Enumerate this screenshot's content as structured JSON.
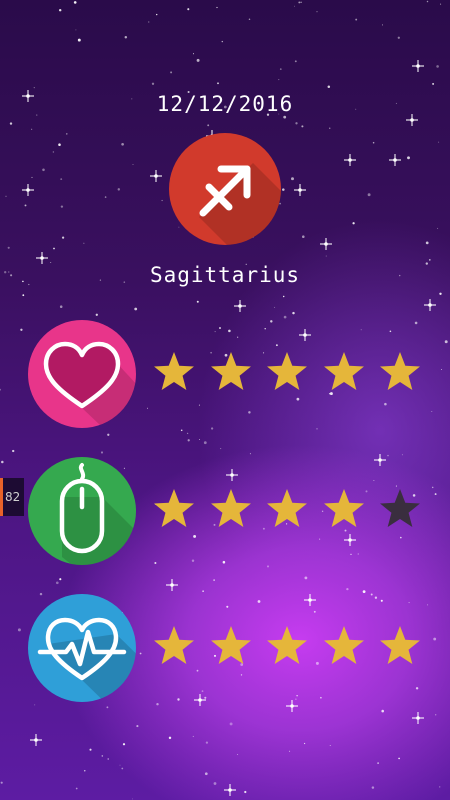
{
  "header": {
    "date": "12/12/2016",
    "sign_name": "Sagittarius",
    "sign_icon": "sagittarius-arrow-icon"
  },
  "ratings": [
    {
      "category_icon": "heart-icon",
      "circle_color": "#e8358a",
      "rating": 5,
      "max": 5
    },
    {
      "category_icon": "computer-mouse-icon",
      "circle_color": "#35a94f",
      "rating": 4,
      "max": 5
    },
    {
      "category_icon": "heartbeat-icon",
      "circle_color": "#2f9fd8",
      "rating": 5,
      "max": 5
    }
  ],
  "colors": {
    "star_filled": "#e5b63a",
    "star_empty": "#3a2e3f",
    "zodiac_circle": "#d13a2c"
  },
  "side_tab": {
    "label": "82"
  }
}
